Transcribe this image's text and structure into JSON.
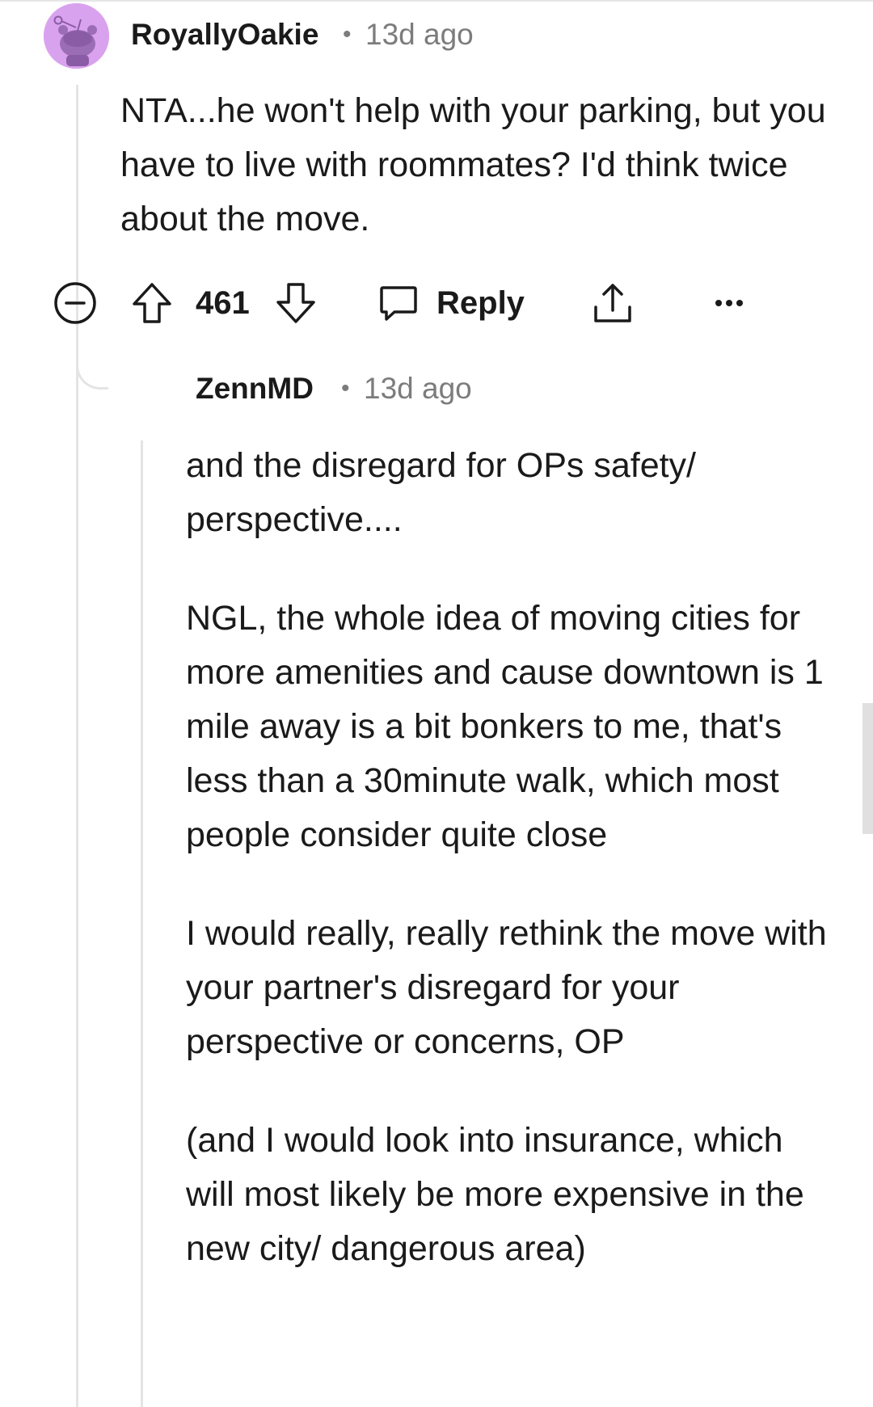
{
  "comment": {
    "author": "RoyallyOakie",
    "separator": "•",
    "time": "13d ago",
    "body": "NTA...he won't help with your parking, but you have to live with roommates? I'd think twice about the move.",
    "avatar_color": "#d9a2ee",
    "actions": {
      "collapse_icon": "collapse-minus-icon",
      "upvote_icon": "upvote-arrow-icon",
      "vote_count": "461",
      "downvote_icon": "downvote-arrow-icon",
      "reply_icon": "chat-bubble-icon",
      "reply_label": "Reply",
      "share_icon": "share-icon",
      "more_icon": "more-options-icon"
    }
  },
  "reply": {
    "author": "ZennMD",
    "separator": "•",
    "time": "13d ago",
    "paragraphs": [
      "and the disregard for OPs safety/ perspective....",
      "NGL, the whole idea of moving cities for more amenities and cause downtown is 1 mile away is a bit bonkers to me, that's less than a 30minute walk, which most people consider quite close",
      "I would really, really rethink the move with your partner's disregard for your perspective or concerns, OP",
      "(and I would look into insurance, which will most likely be more expensive in the new city/ dangerous area)"
    ]
  },
  "colors": {
    "text": "#1a1a1b",
    "meta": "#7c7c7c",
    "thread_line": "#e4e4e4"
  }
}
